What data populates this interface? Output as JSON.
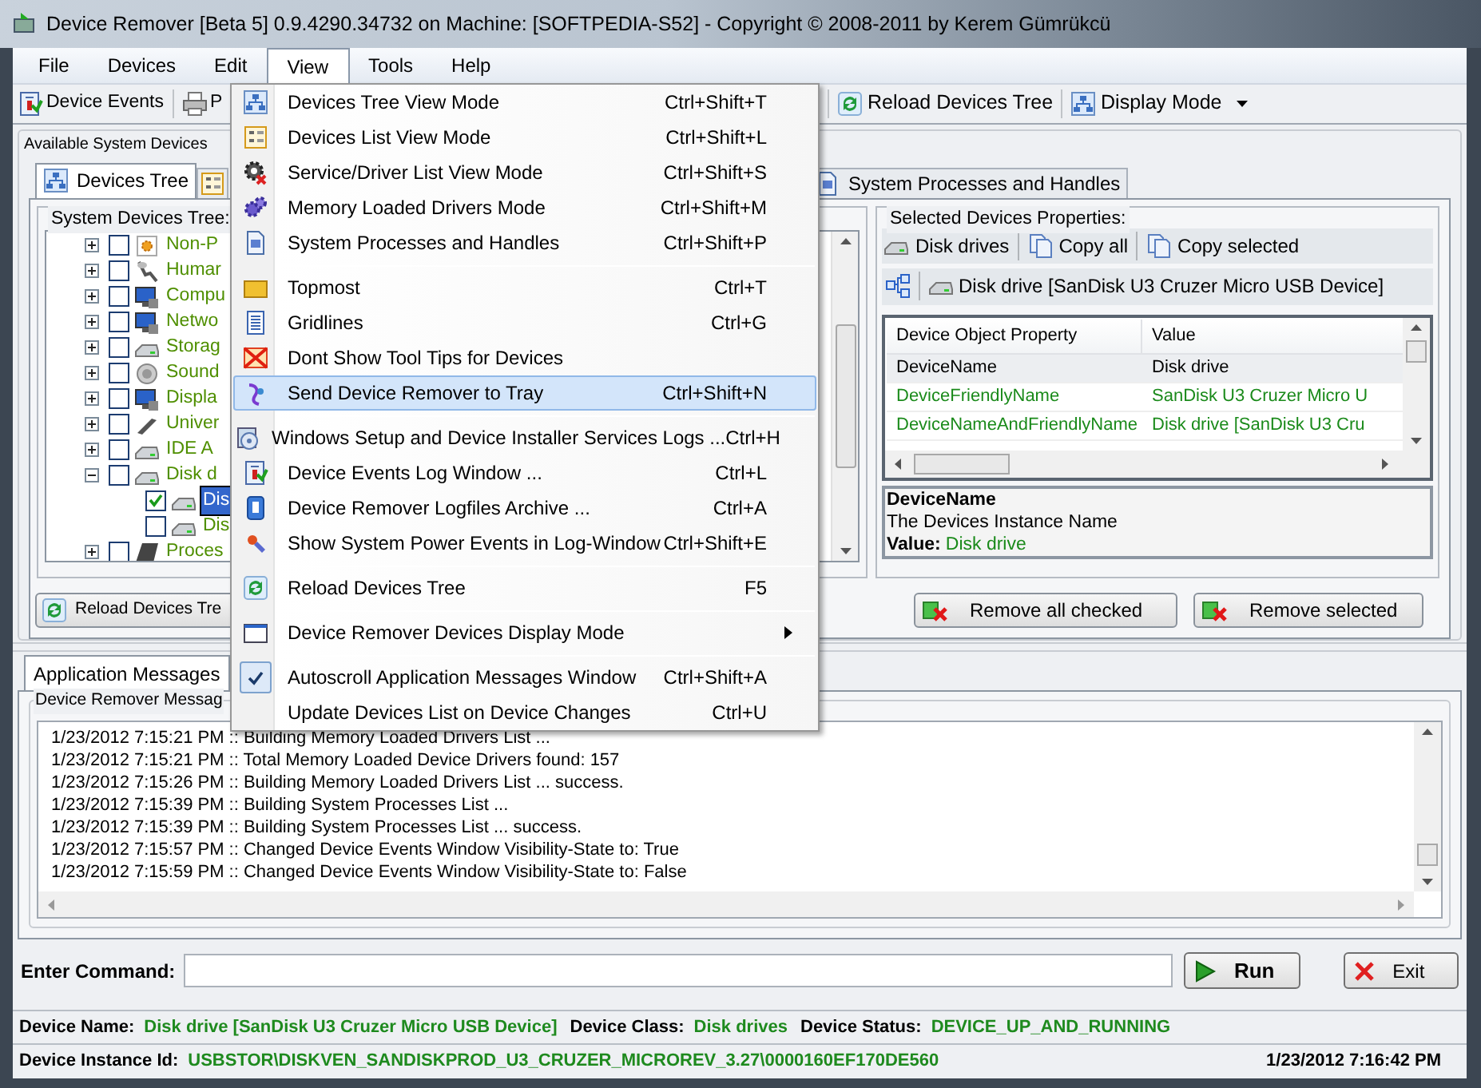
{
  "window": {
    "title": "Device Remover [Beta 5] 0.9.4290.34732 on Machine: [SOFTPEDIA-S52] - Copyright © 2008-2011 by Kerem Gümrükcü"
  },
  "menu_bar": [
    {
      "label": "File",
      "selected": false
    },
    {
      "label": "Devices",
      "selected": false
    },
    {
      "label": "Edit",
      "selected": false
    },
    {
      "label": "View",
      "selected": true
    },
    {
      "label": "Tools",
      "selected": false
    },
    {
      "label": "Help",
      "selected": false
    }
  ],
  "toolbar": {
    "left": [
      {
        "label": "Device Events",
        "kind": "events"
      },
      {
        "label": "P",
        "kind": "print"
      }
    ],
    "right": [
      {
        "label": "Reload Devices Tree",
        "kind": "reload",
        "dropdown": false
      },
      {
        "label": "Display Mode",
        "kind": "display",
        "dropdown": true
      }
    ]
  },
  "view_menu": [
    {
      "kind": "item",
      "label": "Devices Tree View Mode",
      "shortcut": "Ctrl+Shift+T",
      "selected": false,
      "checked": false,
      "submenu": false
    },
    {
      "kind": "item",
      "label": "Devices List View Mode",
      "shortcut": "Ctrl+Shift+L",
      "selected": false,
      "checked": false,
      "submenu": false
    },
    {
      "kind": "item",
      "label": "Service/Driver List View Mode",
      "shortcut": "Ctrl+Shift+S",
      "selected": false,
      "checked": false,
      "submenu": false
    },
    {
      "kind": "item",
      "label": "Memory Loaded Drivers Mode",
      "shortcut": "Ctrl+Shift+M",
      "selected": false,
      "checked": false,
      "submenu": false
    },
    {
      "kind": "item",
      "label": "System Processes and Handles",
      "shortcut": "Ctrl+Shift+P",
      "selected": false,
      "checked": false,
      "submenu": false
    },
    {
      "kind": "separator"
    },
    {
      "kind": "item",
      "label": "Topmost",
      "shortcut": "Ctrl+T",
      "selected": false,
      "checked": false,
      "submenu": false
    },
    {
      "kind": "item",
      "label": "Gridlines",
      "shortcut": "Ctrl+G",
      "selected": false,
      "checked": false,
      "submenu": false
    },
    {
      "kind": "item",
      "label": "Dont Show Tool Tips for Devices",
      "selected": false,
      "checked": false,
      "submenu": false
    },
    {
      "kind": "item",
      "label": "Send Device Remover to Tray",
      "shortcut": "Ctrl+Shift+N",
      "selected": true,
      "checked": false,
      "submenu": false
    },
    {
      "kind": "separator"
    },
    {
      "kind": "item",
      "label": "Windows Setup and Device Installer Services Logs ...",
      "shortcut": "Ctrl+H",
      "selected": false,
      "checked": false,
      "submenu": false
    },
    {
      "kind": "item",
      "label": "Device Events Log Window ...",
      "shortcut": "Ctrl+L",
      "selected": false,
      "checked": false,
      "submenu": false
    },
    {
      "kind": "item",
      "label": "Device Remover Logfiles Archive ...",
      "shortcut": "Ctrl+A",
      "selected": false,
      "checked": false,
      "submenu": false
    },
    {
      "kind": "item",
      "label": "Show System Power Events in Log-Window",
      "shortcut": "Ctrl+Shift+E",
      "selected": false,
      "checked": false,
      "submenu": false
    },
    {
      "kind": "separator"
    },
    {
      "kind": "item",
      "label": "Reload Devices Tree",
      "shortcut": "F5",
      "selected": false,
      "checked": false,
      "submenu": false
    },
    {
      "kind": "separator"
    },
    {
      "kind": "item",
      "label": "Device Remover Devices Display Mode",
      "selected": false,
      "checked": false,
      "submenu": true
    },
    {
      "kind": "separator"
    },
    {
      "kind": "item",
      "label": "Autoscroll Application Messages Window",
      "shortcut": "Ctrl+Shift+A",
      "selected": false,
      "checked": true,
      "submenu": false
    },
    {
      "kind": "item",
      "label": "Update Devices List on Device Changes",
      "shortcut": "Ctrl+U",
      "selected": false,
      "checked": false,
      "submenu": false
    }
  ],
  "devices_panel": {
    "title": "Available System Devices",
    "tabs": [
      {
        "label": "Devices Tree",
        "selected": true
      },
      {
        "kind": "icon",
        "selected": false
      },
      {
        "label": "System Processes and Handles",
        "selected": false
      }
    ],
    "tree": {
      "title": "System Devices Tree:",
      "items": [
        {
          "label": "Non-P",
          "expanded": false,
          "checked": false,
          "selected": false
        },
        {
          "label": "Humar",
          "expanded": false,
          "checked": false,
          "selected": false
        },
        {
          "label": "Compu",
          "expanded": false,
          "checked": false,
          "selected": false
        },
        {
          "label": "Netwo",
          "expanded": false,
          "checked": false,
          "selected": false
        },
        {
          "label": "Storag",
          "expanded": false,
          "checked": false,
          "selected": false
        },
        {
          "label": "Sound",
          "expanded": false,
          "checked": false,
          "selected": false
        },
        {
          "label": "Displa",
          "expanded": false,
          "checked": false,
          "selected": false
        },
        {
          "label": "Univer",
          "expanded": false,
          "checked": false,
          "selected": false
        },
        {
          "label": "IDE A",
          "expanded": false,
          "checked": false,
          "selected": false
        },
        {
          "label": "Disk d",
          "expanded": true,
          "checked": false,
          "selected": false,
          "children": [
            {
              "label": "Dis",
              "checked": true,
              "selected": true
            },
            {
              "label": "Dis",
              "checked": false,
              "selected": false
            }
          ]
        },
        {
          "label": "Proces",
          "expanded": false,
          "checked": false,
          "selected": false
        }
      ]
    },
    "properties": {
      "title": "Selected Devices Properties:",
      "toolbar": [
        "Disk drives",
        "Copy all",
        "Copy selected"
      ],
      "path": "Disk drive [SanDisk U3 Cruzer Micro USB Device]",
      "columns": [
        "Device Object Property",
        "Value"
      ],
      "rows": [
        {
          "property": "DeviceName",
          "value": "Disk drive",
          "selected": true
        },
        {
          "property": "DeviceFriendlyName",
          "value": "SanDisk U3 Cruzer Micro U",
          "selected": false
        },
        {
          "property": "DeviceNameAndFriendlyName",
          "value": "Disk drive [SanDisk U3 Cru",
          "selected": false
        }
      ],
      "description": {
        "name": "DeviceName",
        "text": "The Devices Instance Name",
        "value_label": "Value:",
        "value": "Disk drive"
      }
    },
    "buttons": {
      "reload": "Reload Devices Tre",
      "remove_checked": "Remove all checked",
      "remove_selected": "Remove selected"
    }
  },
  "messages": {
    "tabs": [
      {
        "label": "Application Messages",
        "selected": true
      }
    ],
    "title": "Device Remover Messag",
    "lines": [
      "1/23/2012 7:15:21 PM :: Building Memory Loaded Drivers List ...",
      "1/23/2012 7:15:21 PM :: Total Memory Loaded Device Drivers found: 157",
      "1/23/2012 7:15:26 PM :: Building Memory Loaded Drivers List ... success.",
      "1/23/2012 7:15:39 PM :: Building System Processes List ...",
      "1/23/2012 7:15:39 PM :: Building System Processes List ... success.",
      "1/23/2012 7:15:57 PM :: Changed Device Events Window Visibility-State to: True",
      "1/23/2012 7:15:59 PM :: Changed Device Events Window Visibility-State to: False"
    ]
  },
  "command": {
    "label": "Enter Command:",
    "run": "Run",
    "exit": "Exit"
  },
  "status_bar": {
    "row_1": [
      {
        "label": "Device Name:",
        "value": "Disk drive [SanDisk U3 Cruzer Micro USB Device]"
      },
      {
        "label": "Device Class:",
        "value": "Disk drives"
      },
      {
        "label": "Device Status:",
        "value": "DEVICE_UP_AND_RUNNING"
      }
    ],
    "row_2": [
      {
        "label": "Device Instance Id:",
        "value": "USBSTOR\\DISKVEN_SANDISKPROD_U3_CRUZER_MICROREV_3.27\\0000160EF170DE560"
      }
    ],
    "time": "1/23/2012 7:16:42 PM"
  }
}
